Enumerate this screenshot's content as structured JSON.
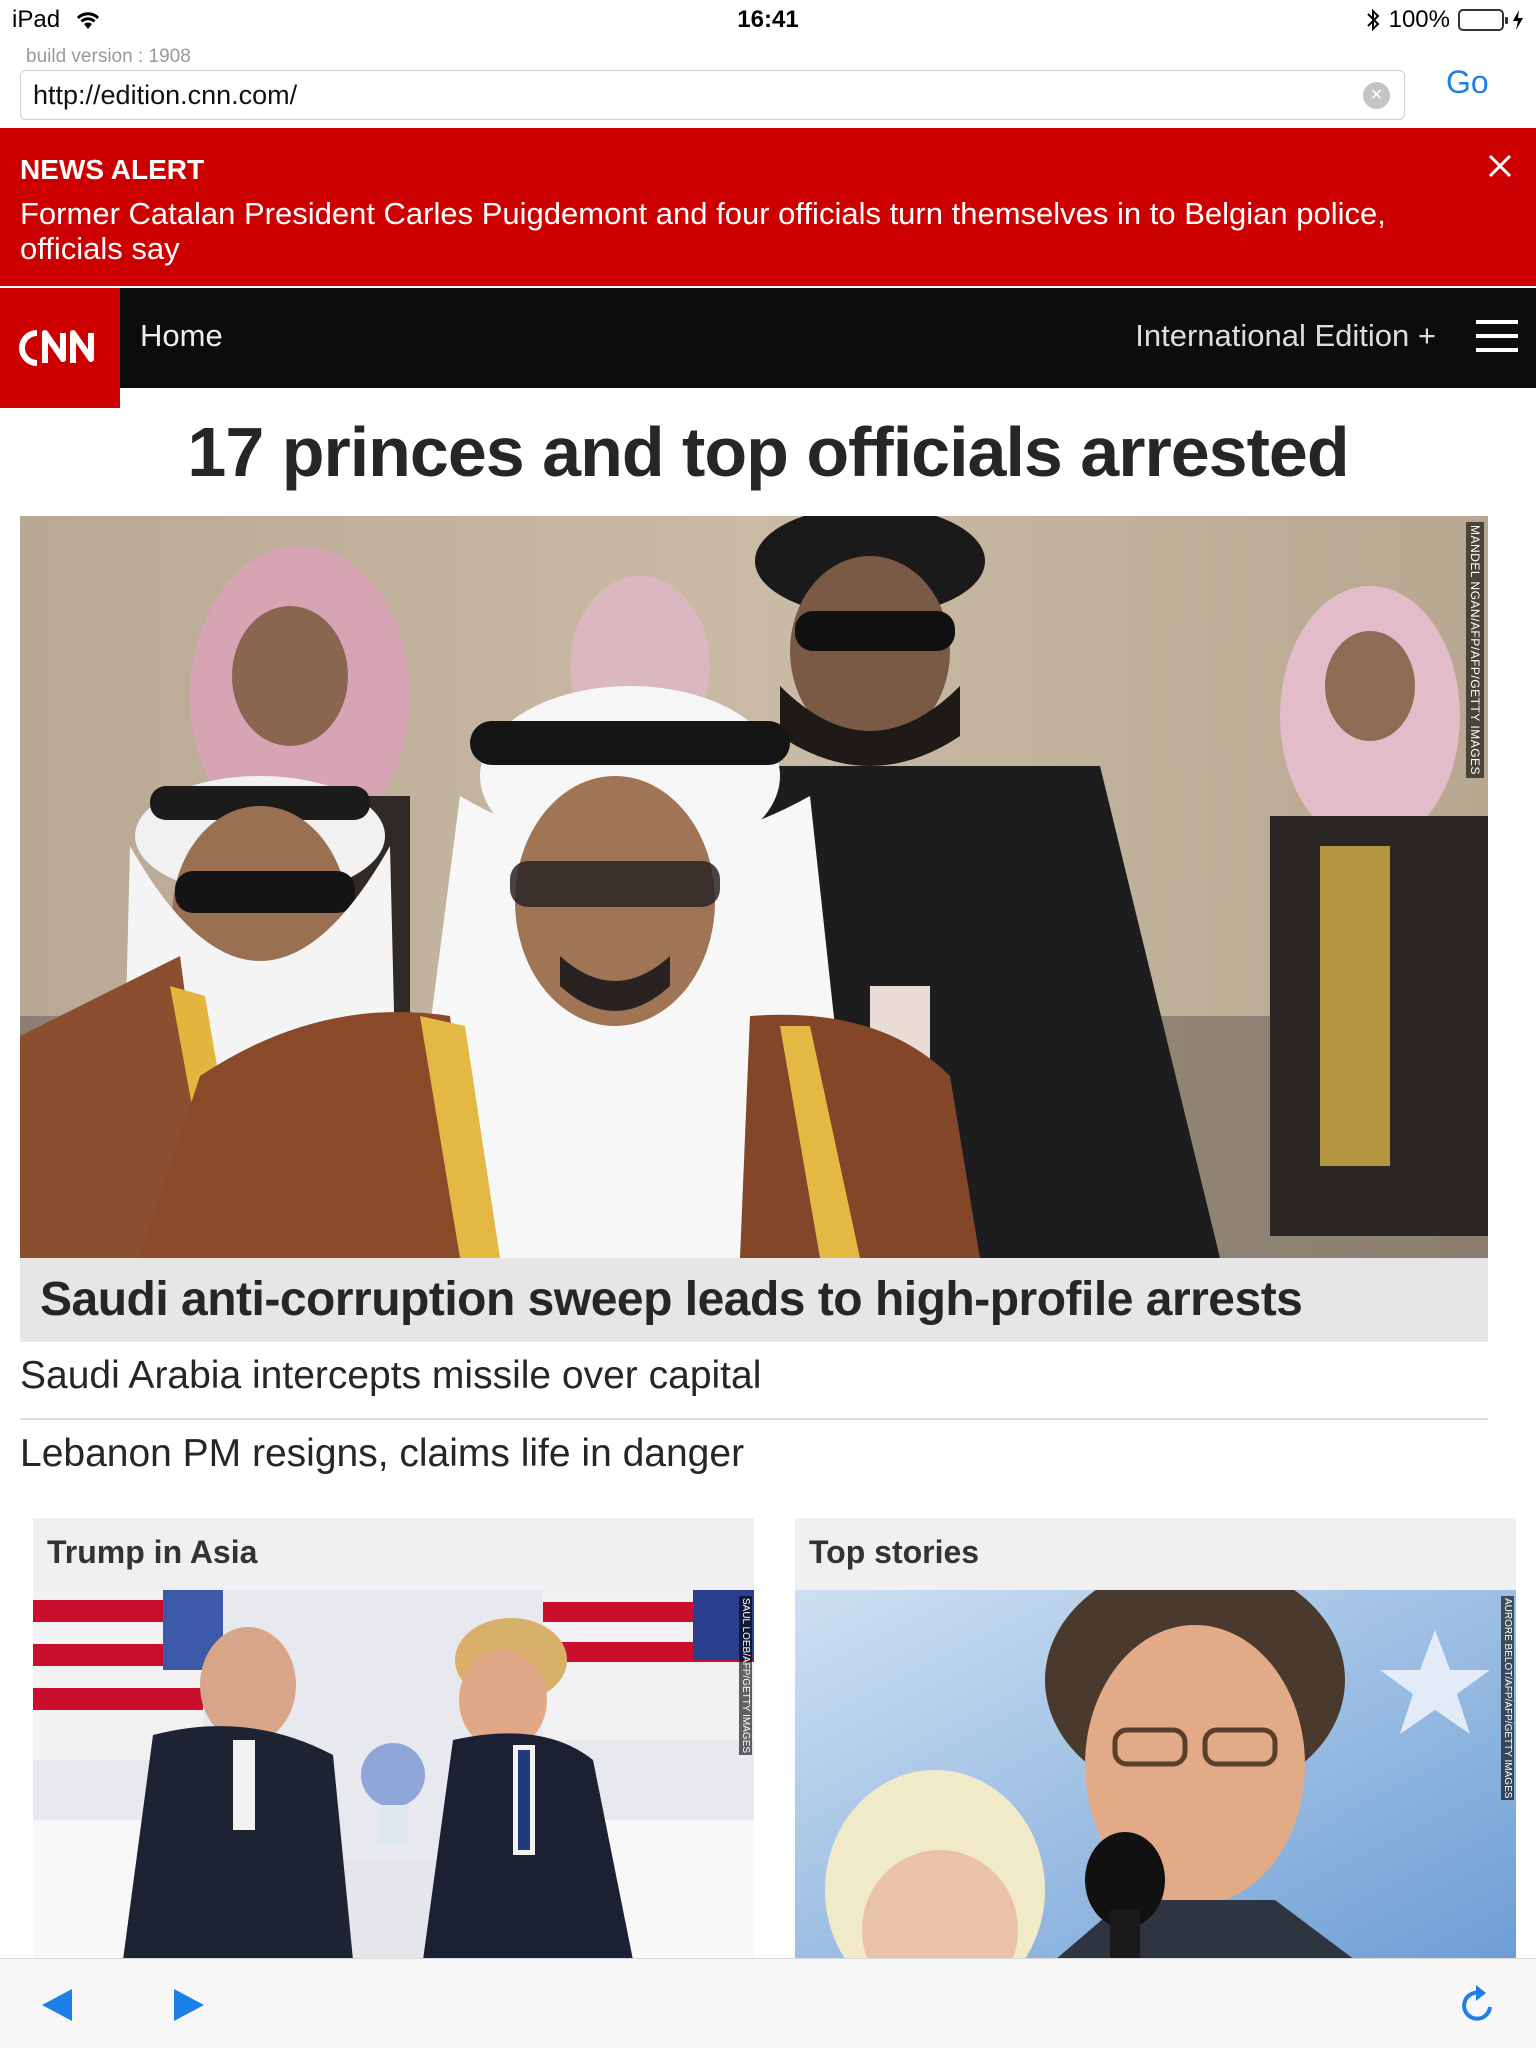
{
  "status_bar": {
    "device": "iPad",
    "time": "16:41",
    "battery": "100%",
    "battery_level": 1.0
  },
  "browser": {
    "build_version": "build version : 1908",
    "url": "http://edition.cnn.com/",
    "go_label": "Go"
  },
  "news_alert": {
    "label": "NEWS ALERT",
    "headline": "Former Catalan President Carles Puigdemont and four officials turn themselves in to Belgian police, officials say"
  },
  "nav": {
    "logo": "CNN",
    "home": "Home",
    "edition": "International Edition +"
  },
  "main": {
    "headline": "17 princes and top officials arrested",
    "hero_credit": "MANDEL NGAN/AFP/AFP/GETTY IMAGES",
    "hero_caption": "Saudi anti-corruption sweep leads to high-profile arrests",
    "links": [
      "Saudi Arabia intercepts missile over capital",
      "Lebanon PM resigns, claims life in danger"
    ]
  },
  "cards": [
    {
      "title": "Trump in Asia",
      "credit": "SAUL LOEB/AFP/GETTY IMAGES"
    },
    {
      "title": "Top stories",
      "credit": "AURORE BELOT/AFP/AFP/GETTY IMAGES"
    }
  ],
  "colors": {
    "cnn_red": "#cc0000",
    "nav_black": "#0c0c0c",
    "link_blue": "#1e7fe6"
  }
}
